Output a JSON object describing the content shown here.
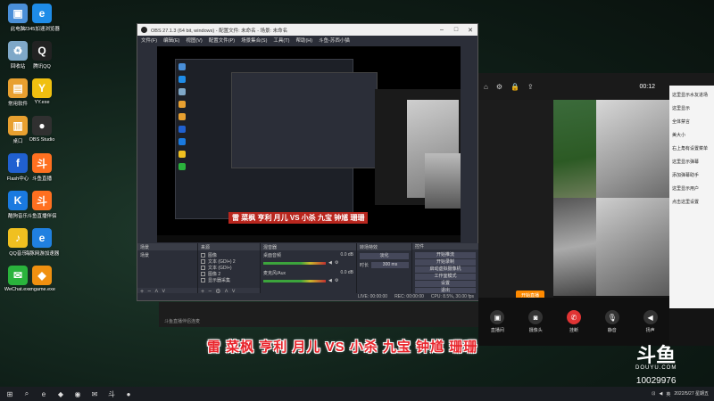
{
  "desktop": {
    "icons": [
      {
        "label": "此电脑",
        "glyph": "▣",
        "color": "#4a8fd8"
      },
      {
        "label": "2345加速浏览器",
        "glyph": "e",
        "color": "#1e8ce8"
      },
      {
        "label": "回收站",
        "glyph": "♻",
        "color": "#7fa8c8"
      },
      {
        "label": "腾讯QQ",
        "glyph": "Q",
        "color": "#222222"
      },
      {
        "label": "常用软件",
        "glyph": "▤",
        "color": "#e8a030"
      },
      {
        "label": "YY.exe",
        "glyph": "Y",
        "color": "#f0c010"
      },
      {
        "label": "桌口",
        "glyph": "▥",
        "color": "#e8a030"
      },
      {
        "label": "OBS Studio",
        "glyph": "●",
        "color": "#303030"
      },
      {
        "label": "Flash中心",
        "glyph": "f",
        "color": "#2060d0"
      },
      {
        "label": "斗鱼直播",
        "glyph": "斗",
        "color": "#ff7020"
      },
      {
        "label": "酷狗音乐",
        "glyph": "K",
        "color": "#1a7ae0"
      },
      {
        "label": "斗鱼直播伴侣",
        "glyph": "斗",
        "color": "#ff7020"
      },
      {
        "label": "QQ音乐",
        "glyph": "♪",
        "color": "#f0c020"
      },
      {
        "label": "海豚网游加速器",
        "glyph": "e",
        "color": "#2080e0"
      },
      {
        "label": "WeChat.exe",
        "glyph": "✉",
        "color": "#2ab33c"
      },
      {
        "label": "cngame.exe",
        "glyph": "◆",
        "color": "#f09010"
      }
    ]
  },
  "obs": {
    "title": "OBS 27.1.3 (64 bit, windows) - 配置文件: 未命名 - 场景: 未命名",
    "menu": [
      "文件(F)",
      "编辑(E)",
      "视图(V)",
      "配置文件(P)",
      "场景集合(S)",
      "工具(T)",
      "帮助(H)",
      "斗鱼-苏西小猫"
    ],
    "preview_caption": "雷 菜枫 亨利 月儿 VS 小杀 九宝 钟馗 珊珊",
    "docks": {
      "scenes_title": "场景",
      "scenes": [
        "场景"
      ],
      "sources_title": "来源",
      "sources": [
        "图像",
        "文本 (GDI+) 2",
        "文本 (GDI+)",
        "图像 2",
        "显示器采集"
      ],
      "mixer_title": "混音器",
      "mixer": [
        {
          "name": "桌面音频",
          "db": "0.0 dB"
        },
        {
          "name": "麦克风/Aux",
          "db": "0.0 dB"
        }
      ],
      "transition_title": "转场特效",
      "transition_type": "淡化",
      "transition_duration_label": "时长",
      "transition_duration": "300 ms",
      "controls_title": "控件",
      "controls": [
        "开始推流",
        "开始录制",
        "启动虚拟摄像机",
        "工作室模式",
        "设置",
        "退出"
      ]
    },
    "status": [
      "LIVE: 00:00:00",
      "REC: 00:00:00",
      "CPU: 8.5%, 30.00 fps"
    ]
  },
  "streaming_app": {
    "clock": "00:12",
    "start_button": "开始直播",
    "chat_messages": [
      "这里显示水友进场",
      "这里显示",
      "全体禁言",
      "美大小",
      "右上角有设置菜单",
      "这里显示弹幕",
      "添加弹幕助手",
      "这里显示用户",
      "点击这里设置"
    ],
    "controls": [
      {
        "label": "直播间",
        "glyph": "▣"
      },
      {
        "label": "摄像头",
        "glyph": "◙"
      },
      {
        "label": "挂断",
        "glyph": "✆"
      },
      {
        "label": "静音",
        "glyph": "🎙"
      },
      {
        "label": "扬声",
        "glyph": "◀"
      }
    ]
  },
  "overlay": {
    "caption": "雷 菜枫 亨利 月儿 VS 小杀 九宝 钟馗 珊珊",
    "douyu_logo": "斗鱼",
    "douyu_url": "DOUYU.COM",
    "room_id": "10029976",
    "strip_text": "斗鱼直播伴侣连麦"
  },
  "taskbar": {
    "start_glyph": "⊞",
    "search_glyph": "⌕",
    "apps": [
      "e",
      "◆",
      "◉",
      "✉",
      "斗",
      "●"
    ],
    "time": "",
    "date": "2022/5/27 星期五"
  }
}
